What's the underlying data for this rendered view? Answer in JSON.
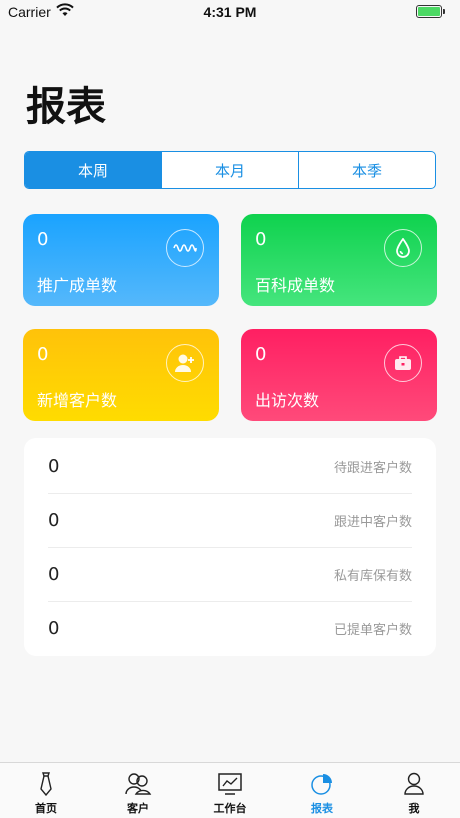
{
  "status_bar": {
    "carrier": "Carrier",
    "time": "4:31 PM",
    "battery_level": 1.0
  },
  "page": {
    "title": "报表"
  },
  "segments": [
    {
      "label": "本周",
      "active": true
    },
    {
      "label": "本月",
      "active": false
    },
    {
      "label": "本季",
      "active": false
    }
  ],
  "cards": {
    "promotion": {
      "value": "0",
      "label": "推广成单数",
      "icon": "wave-icon",
      "color": "#1aa3ff"
    },
    "baike": {
      "value": "0",
      "label": "百科成单数",
      "icon": "drop-icon",
      "color": "#0fd24e"
    },
    "new_customers": {
      "value": "0",
      "label": "新增客户数",
      "icon": "add-user-icon",
      "color": "#ffc20a"
    },
    "visits": {
      "value": "0",
      "label": "出访次数",
      "icon": "briefcase-icon",
      "color": "#ff1f62"
    }
  },
  "summary": [
    {
      "value": "0",
      "label": "待跟进客户数"
    },
    {
      "value": "0",
      "label": "跟进中客户数"
    },
    {
      "value": "0",
      "label": "私有库保有数"
    },
    {
      "value": "0",
      "label": "已提单客户数"
    }
  ],
  "tabs": [
    {
      "label": "首页",
      "icon": "tie-icon",
      "active": false
    },
    {
      "label": "客户",
      "icon": "customers-icon",
      "active": false
    },
    {
      "label": "工作台",
      "icon": "monitor-chart-icon",
      "active": false
    },
    {
      "label": "报表",
      "icon": "pie-chart-icon",
      "active": true
    },
    {
      "label": "我",
      "icon": "person-icon",
      "active": false
    }
  ],
  "colors": {
    "accent": "#1a8fe3",
    "background": "#f7f7f7"
  }
}
